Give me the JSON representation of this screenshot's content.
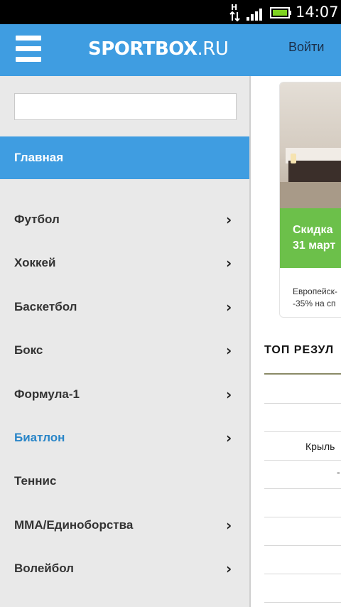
{
  "status_bar": {
    "network_type": "H",
    "time": "14:07"
  },
  "header": {
    "logo_main": "SPORTBOX",
    "logo_suffix": ".RU",
    "login_label": "Войти"
  },
  "sidebar": {
    "search": {
      "value": "",
      "placeholder": ""
    },
    "home_label": "Главная",
    "items": [
      {
        "label": "Футбол",
        "has_submenu": true,
        "active": false
      },
      {
        "label": "Хоккей",
        "has_submenu": true,
        "active": false
      },
      {
        "label": "Баскетбол",
        "has_submenu": true,
        "active": false
      },
      {
        "label": "Бокс",
        "has_submenu": true,
        "active": false
      },
      {
        "label": "Формула-1",
        "has_submenu": true,
        "active": false
      },
      {
        "label": "Биатлон",
        "has_submenu": true,
        "active": true
      },
      {
        "label": "Теннис",
        "has_submenu": false,
        "active": false
      },
      {
        "label": "ММА/Единоборства",
        "has_submenu": true,
        "active": false
      },
      {
        "label": "Волейбол",
        "has_submenu": true,
        "active": false
      }
    ],
    "chevron": "›"
  },
  "content": {
    "ad": {
      "headline_line1": "Скидка",
      "headline_line2": "31 март",
      "text_line1": "Европейск-",
      "text_line2": "-35% на сп"
    },
    "section_title": "ТОП РЕЗУЛ",
    "rows": [
      {
        "text": ""
      },
      {
        "text": ""
      },
      {
        "text": "Крыль"
      },
      {
        "text": "-"
      },
      {
        "text": ""
      },
      {
        "text": ""
      },
      {
        "text": ""
      },
      {
        "text": ""
      }
    ]
  },
  "colors": {
    "accent": "#3f9de1",
    "active_item": "#2a86c8",
    "sidebar_bg": "#e9e9e9",
    "ad_green": "#6cc04a"
  }
}
